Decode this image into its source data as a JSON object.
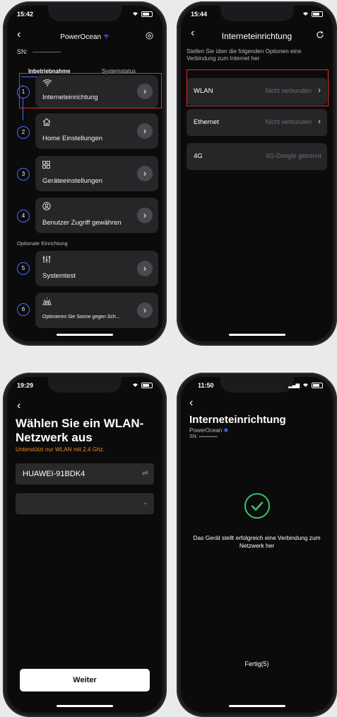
{
  "phone1": {
    "time": "15:42",
    "title": "PowerOcean",
    "sn_label": "SN:",
    "tabs": [
      "Inbetriebnahme",
      "Systemstatus"
    ],
    "steps": [
      {
        "num": "1",
        "label": "Interneteinrichtung",
        "icon": "wifi-icon"
      },
      {
        "num": "2",
        "label": "Home Einstellungen",
        "icon": "home-icon"
      },
      {
        "num": "3",
        "label": "Geräteeinstellungen",
        "icon": "grid-icon"
      },
      {
        "num": "4",
        "label": "Benutzer Zugriff gewähren",
        "icon": "user-icon"
      }
    ],
    "optional_heading": "Optionale Einrichtung",
    "optional_steps": [
      {
        "num": "5",
        "label": "Systemtest",
        "icon": "sliders-icon"
      },
      {
        "num": "6",
        "label": "Optimieren Sie Sonne gegen Sch...",
        "icon": "solar-icon"
      }
    ]
  },
  "phone2": {
    "time": "15:44",
    "title": "Interneteinrichtung",
    "description": "Stellen Sie über die folgenden Optionen eine Verbindung zum Internet her",
    "rows": [
      {
        "label": "WLAN",
        "value": "Nicht verbunden"
      },
      {
        "label": "Ethernet",
        "value": "Nicht verbunden"
      },
      {
        "label": "4G",
        "value": "4G-Dongle getrennt"
      }
    ]
  },
  "phone3": {
    "time": "19:29",
    "title": "Wählen Sie ein WLAN-Netzwerk aus",
    "subtitle": "Unterstützt nur WLAN mit 2,4 Ghz.",
    "network": "HUAWEI-91BDK4",
    "password": "",
    "button": "Weiter"
  },
  "phone4": {
    "time": "11:50",
    "title": "Interneteinrichtung",
    "device": "PowerOcean",
    "sn_label": "SN:",
    "sn_masked": "•••••••••••••••",
    "message": "Das Gerät stellt erfolgreich eine Verbindung zum Netzwerk her",
    "done": "Fertig(5)"
  },
  "colors": {
    "accent": "#4a6cff",
    "highlight": "#e22d2d",
    "success": "#3bc26b",
    "warning": "#f08a24"
  }
}
